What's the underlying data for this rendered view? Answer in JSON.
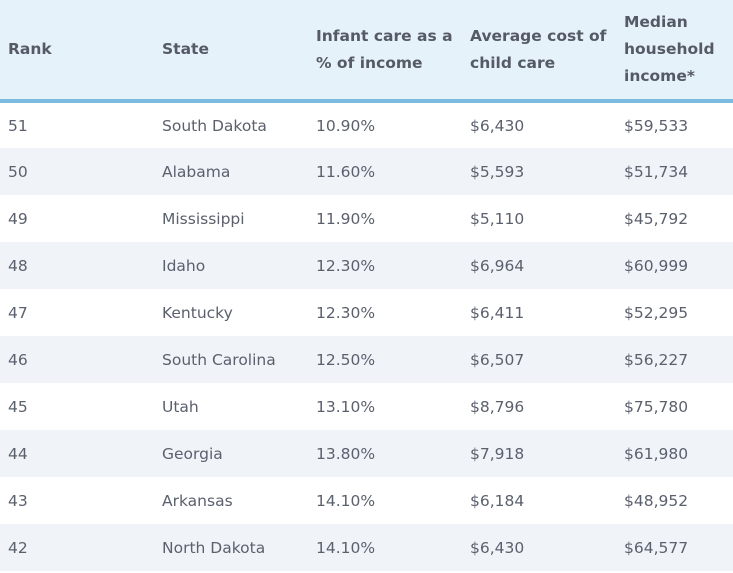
{
  "table": {
    "headers": {
      "rank": "Rank",
      "state": "State",
      "pct_line1": "Infant care as a",
      "pct_line2": "% of income",
      "cost_line1": "Average cost of",
      "cost_line2": "child care",
      "income_line1": "Median",
      "income_line2": "household",
      "income_line3": "income*"
    },
    "rows": [
      {
        "rank": "51",
        "state": "South Dakota",
        "pct": "10.90%",
        "cost": "$6,430",
        "income": "$59,533"
      },
      {
        "rank": "50",
        "state": "Alabama",
        "pct": "11.60%",
        "cost": "$5,593",
        "income": "$51,734"
      },
      {
        "rank": "49",
        "state": "Mississippi",
        "pct": "11.90%",
        "cost": "$5,110",
        "income": "$45,792"
      },
      {
        "rank": "48",
        "state": "Idaho",
        "pct": "12.30%",
        "cost": "$6,964",
        "income": "$60,999"
      },
      {
        "rank": "47",
        "state": "Kentucky",
        "pct": "12.30%",
        "cost": "$6,411",
        "income": "$52,295"
      },
      {
        "rank": "46",
        "state": "South Carolina",
        "pct": "12.50%",
        "cost": "$6,507",
        "income": "$56,227"
      },
      {
        "rank": "45",
        "state": "Utah",
        "pct": "13.10%",
        "cost": "$8,796",
        "income": "$75,780"
      },
      {
        "rank": "44",
        "state": "Georgia",
        "pct": "13.80%",
        "cost": "$7,918",
        "income": "$61,980"
      },
      {
        "rank": "43",
        "state": "Arkansas",
        "pct": "14.10%",
        "cost": "$6,184",
        "income": "$48,952"
      },
      {
        "rank": "42",
        "state": "North Dakota",
        "pct": "14.10%",
        "cost": "$6,430",
        "income": "$64,577"
      }
    ]
  },
  "colors": {
    "header_bg": "#e6f2fa",
    "header_border": "#7bbbe0",
    "row_alt_bg": "#f0f4f9",
    "text": "#5b606d"
  }
}
